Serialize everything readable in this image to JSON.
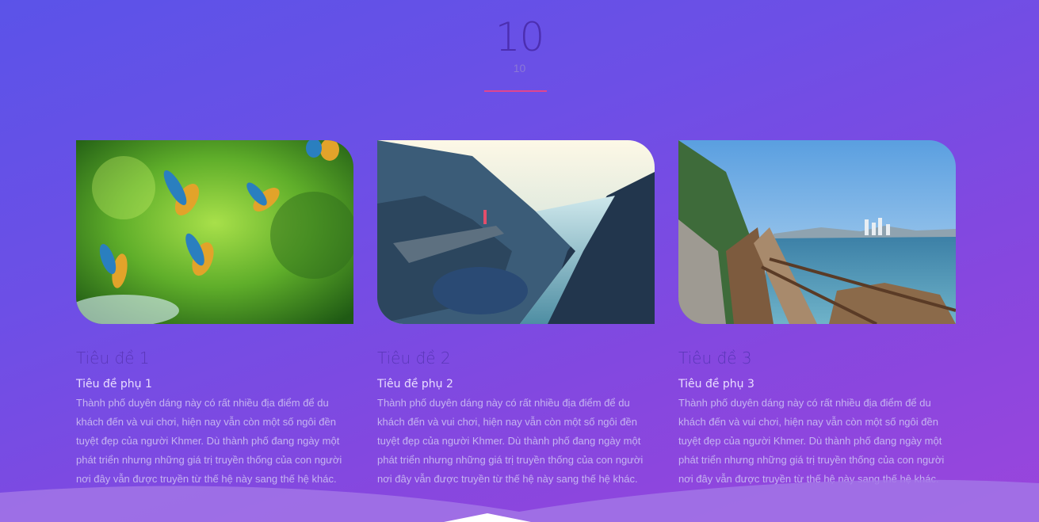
{
  "section": {
    "title": "10",
    "subtitle": "10"
  },
  "cards": [
    {
      "title": "Tiêu đề 1",
      "subtitle": "Tiêu đề phụ 1",
      "text": "Thành phố duyên dáng này có rất nhiều địa điểm để du khách đến và vui chơi, hiện nay vẫn còn một số ngôi đền tuyệt đẹp của người Khmer. Dù thành phố đang ngày một phát triển nhưng những giá trị truyền thống của con người nơi đây vẫn được truyền từ thế hệ này sang thế hệ khác."
    },
    {
      "title": "Tiêu đề 2",
      "subtitle": "Tiêu đề phụ 2",
      "text": "Thành phố duyên dáng này có rất nhiều địa điểm để du khách đến và vui chơi, hiện nay vẫn còn một số ngôi đền tuyệt đẹp của người Khmer. Dù thành phố đang ngày một phát triển nhưng những giá trị truyền thống của con người nơi đây vẫn được truyền từ thế hệ này sang thế hệ khác."
    },
    {
      "title": "Tiêu đề 3",
      "subtitle": "Tiêu đề phụ 3",
      "text": "Thành phố duyên dáng này có rất nhiều địa điểm để du khách đến và vui chơi, hiện nay vẫn còn một số ngôi đền tuyệt đẹp của người Khmer. Dù thành phố đang ngày một phát triển nhưng những giá trị truyền thống của con người nơi đây vẫn được truyền từ thế hệ này sang thế hệ khác."
    }
  ],
  "colors": {
    "accent_divider": "#e0458f",
    "title_color": "#4c2eb0"
  }
}
